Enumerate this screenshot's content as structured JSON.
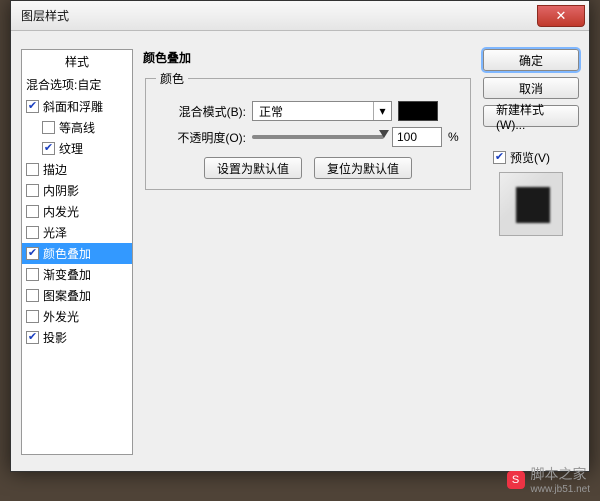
{
  "window": {
    "title": "图层样式",
    "close_glyph": "✕"
  },
  "styles": {
    "heading": "样式",
    "blend_options": "混合选项:自定",
    "items": [
      {
        "label": "斜面和浮雕",
        "checked": true,
        "indent": false,
        "selected": false
      },
      {
        "label": "等高线",
        "checked": false,
        "indent": true,
        "selected": false
      },
      {
        "label": "纹理",
        "checked": true,
        "indent": true,
        "selected": false
      },
      {
        "label": "描边",
        "checked": false,
        "indent": false,
        "selected": false
      },
      {
        "label": "内阴影",
        "checked": false,
        "indent": false,
        "selected": false
      },
      {
        "label": "内发光",
        "checked": false,
        "indent": false,
        "selected": false
      },
      {
        "label": "光泽",
        "checked": false,
        "indent": false,
        "selected": false
      },
      {
        "label": "颜色叠加",
        "checked": true,
        "indent": false,
        "selected": true
      },
      {
        "label": "渐变叠加",
        "checked": false,
        "indent": false,
        "selected": false
      },
      {
        "label": "图案叠加",
        "checked": false,
        "indent": false,
        "selected": false
      },
      {
        "label": "外发光",
        "checked": false,
        "indent": false,
        "selected": false
      },
      {
        "label": "投影",
        "checked": true,
        "indent": false,
        "selected": false
      }
    ]
  },
  "center": {
    "section_title": "颜色叠加",
    "group_legend": "颜色",
    "blend_mode_label": "混合模式(B):",
    "blend_mode_value": "正常",
    "overlay_color": "#000000",
    "opacity_label": "不透明度(O):",
    "opacity_value": "100",
    "opacity_percent_pos": 100,
    "opacity_unit": "%",
    "make_default": "设置为默认值",
    "reset_default": "复位为默认值"
  },
  "right": {
    "ok": "确定",
    "cancel": "取消",
    "new_style": "新建样式(W)...",
    "preview_label": "预览(V)",
    "preview_checked": true
  },
  "watermark": {
    "text": "脚本之家",
    "url_text": "www.jb51.net",
    "logo_text": "S"
  }
}
